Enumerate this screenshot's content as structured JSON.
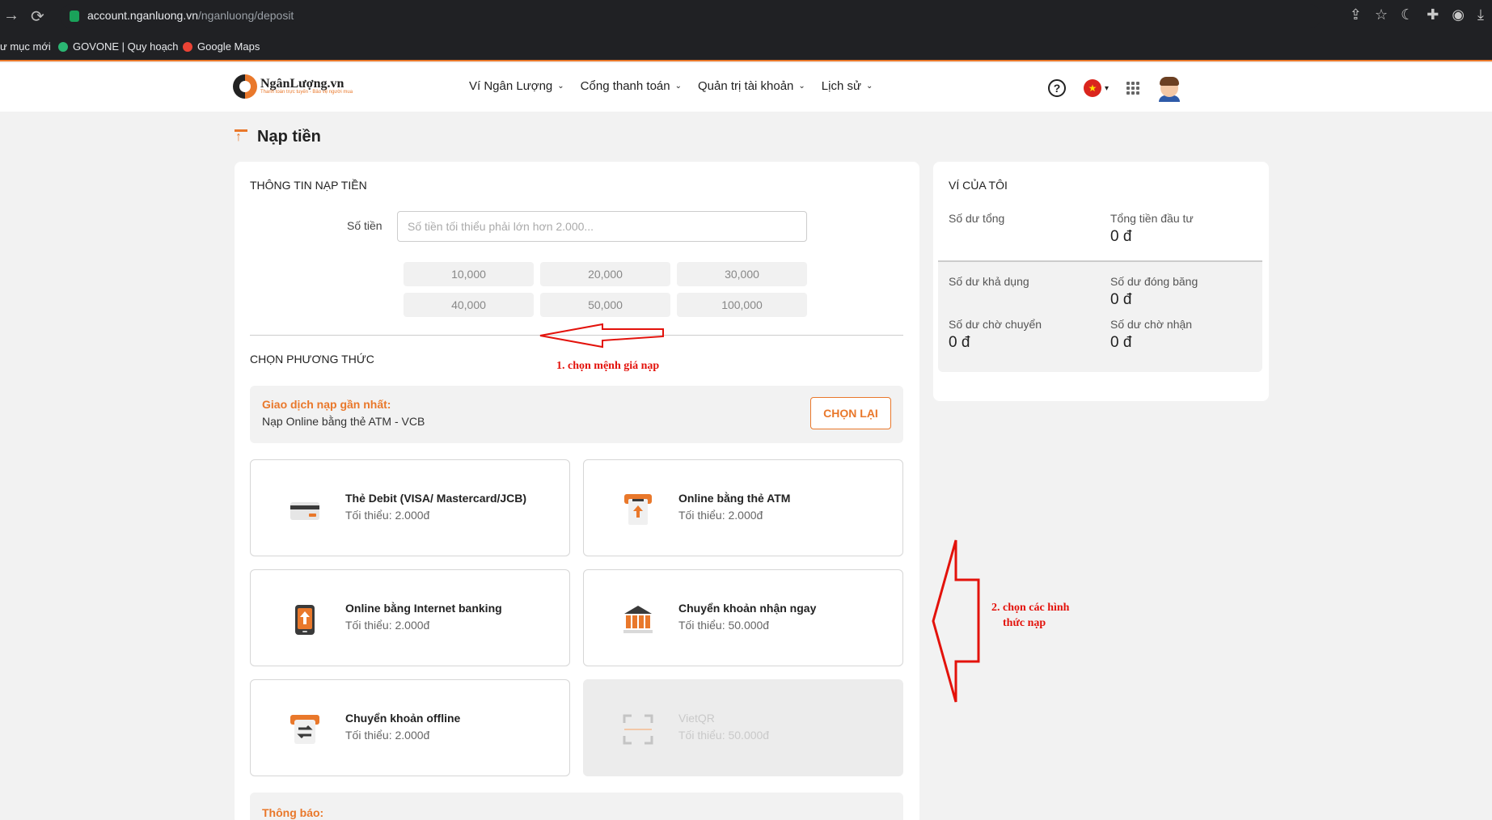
{
  "browser": {
    "url_domain": "account.nganluong.vn",
    "url_path": "/nganluong/deposit",
    "bookmarks": [
      "ư mục mới",
      "GOVONE | Quy hoạch",
      "Google Maps"
    ]
  },
  "header": {
    "logo_name": "NgânLượng.vn",
    "logo_tagline": "Thanh toán trực tuyến - Bảo vệ người mua",
    "nav": [
      "Ví Ngân Lượng",
      "Cổng thanh toán",
      "Quản trị tài khoản",
      "Lịch sử"
    ]
  },
  "page": {
    "title": "Nạp tiền"
  },
  "deposit": {
    "section_title": "THÔNG TIN NẠP TIỀN",
    "amount_label": "Số tiền",
    "amount_placeholder": "Số tiền tối thiểu phải lớn hơn 2.000...",
    "amounts": [
      "10,000",
      "20,000",
      "30,000",
      "40,000",
      "50,000",
      "100,000"
    ],
    "method_section_title": "CHỌN PHƯƠNG THỨC",
    "recent_title": "Giao dịch nạp gần nhất:",
    "recent_desc": "Nạp Online bằng thẻ ATM - VCB",
    "retry_label": "CHỌN LẠI",
    "methods": [
      {
        "name": "Thẻ Debit (VISA/ Mastercard/JCB)",
        "min": "Tối thiểu: 2.000đ",
        "icon": "card-icon"
      },
      {
        "name": "Online bằng thẻ ATM",
        "min": "Tối thiểu: 2.000đ",
        "icon": "atm-icon"
      },
      {
        "name": "Online bằng Internet banking",
        "min": "Tối thiểu: 2.000đ",
        "icon": "mobile-banking-icon"
      },
      {
        "name": "Chuyển khoản nhận ngay",
        "min": "Tối thiểu: 50.000đ",
        "icon": "bank-icon"
      },
      {
        "name": "Chuyển khoản offline",
        "min": "Tối thiểu: 2.000đ",
        "icon": "transfer-icon"
      },
      {
        "name": "VietQR",
        "min": "Tối thiểu: 50.000đ",
        "icon": "qr-scan-icon"
      }
    ],
    "notice_title": "Thông báo:"
  },
  "wallet": {
    "title": "VÍ CỦA TÔI",
    "total_label": "Số dư tổng",
    "invest_label": "Tổng tiền đầu tư",
    "invest_value": "0 đ",
    "available_label": "Số dư khả dụng",
    "frozen_label": "Số dư đóng băng",
    "frozen_value": "0 đ",
    "pending_transfer_label": "Số dư chờ chuyển",
    "pending_transfer_value": "0 đ",
    "pending_receive_label": "Số dư chờ nhận",
    "pending_receive_value": "0 đ"
  },
  "annotations": {
    "step1": "1. chọn mệnh giá nạp",
    "step2_line1": "2. chọn các hình",
    "step2_line2": "thức nạp"
  },
  "colors": {
    "accent": "#e9782b",
    "annotation": "#e3120b"
  }
}
